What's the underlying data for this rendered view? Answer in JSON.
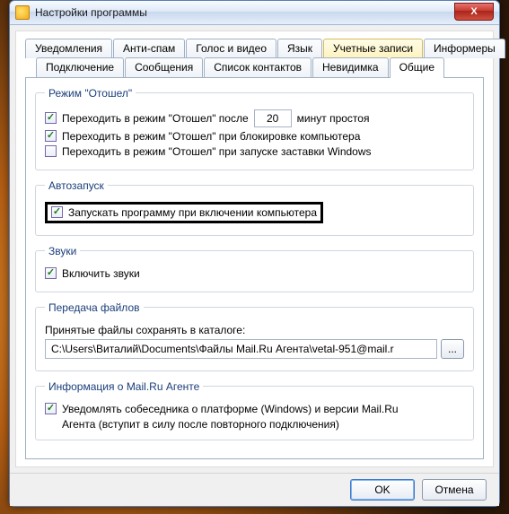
{
  "window": {
    "title": "Настройки программы",
    "close_icon": "X"
  },
  "tabs_row1": [
    {
      "label": "Уведомления",
      "state": "normal"
    },
    {
      "label": "Анти-спам",
      "state": "normal"
    },
    {
      "label": "Голос и видео",
      "state": "normal"
    },
    {
      "label": "Язык",
      "state": "normal"
    },
    {
      "label": "Учетные записи",
      "state": "highlight"
    },
    {
      "label": "Информеры",
      "state": "normal"
    }
  ],
  "tabs_row2": [
    {
      "label": "Подключение",
      "state": "normal"
    },
    {
      "label": "Сообщения",
      "state": "normal"
    },
    {
      "label": "Список контактов",
      "state": "normal"
    },
    {
      "label": "Невидимка",
      "state": "normal"
    },
    {
      "label": "Общие",
      "state": "active"
    }
  ],
  "groups": {
    "away": {
      "legend": "Режим \"Отошел\"",
      "opt1": {
        "checked": true,
        "label": "Переходить в режим \"Отошел\" после",
        "value": "20",
        "suffix": "минут простоя"
      },
      "opt2": {
        "checked": true,
        "label": "Переходить в режим \"Отошел\" при блокировке компьютера"
      },
      "opt3": {
        "checked": false,
        "label": "Переходить в режим \"Отошел\" при запуске заставки Windows"
      }
    },
    "autostart": {
      "legend": "Автозапуск",
      "opt1": {
        "checked": true,
        "label": "Запускать программу при включении компьютера"
      }
    },
    "sounds": {
      "legend": "Звуки",
      "opt1": {
        "checked": true,
        "label": "Включить звуки"
      }
    },
    "files": {
      "legend": "Передача файлов",
      "caption": "Принятые файлы сохранять в каталоге:",
      "path": "C:\\Users\\Виталий\\Documents\\Файлы Mail.Ru Агента\\vetal-951@mail.r",
      "browse": "..."
    },
    "info": {
      "legend": "Информация о Mail.Ru Агенте",
      "opt1": {
        "checked": true,
        "label": "Уведомлять собеседника о платформе (Windows) и версии Mail.Ru",
        "label2": "Агента (вступит в силу после повторного подключения)"
      }
    }
  },
  "buttons": {
    "ok": "OK",
    "cancel": "Отмена"
  }
}
